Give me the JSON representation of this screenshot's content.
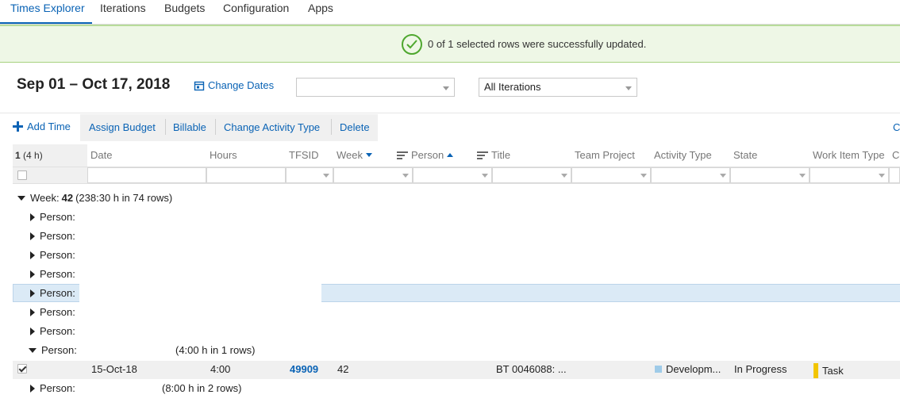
{
  "nav": {
    "tabs": [
      {
        "label": "Times Explorer",
        "active": true
      },
      {
        "label": "Iterations"
      },
      {
        "label": "Budgets"
      },
      {
        "label": "Configuration"
      },
      {
        "label": "Apps"
      }
    ]
  },
  "banner": {
    "message": "0 of 1 selected rows were successfully updated."
  },
  "header": {
    "date_range": "Sep 01 – Oct 17, 2018",
    "change_dates_label": "Change Dates",
    "project_dropdown_value": "",
    "iterations_dropdown_value": "All Iterations"
  },
  "toolbar": {
    "add_time": "Add Time",
    "assign_budget": "Assign Budget",
    "billable": "Billable",
    "change_activity_type": "Change Activity Type",
    "delete": "Delete",
    "overflow": "Co"
  },
  "grid": {
    "selection_count": "1",
    "selection_hours": "(4 h)",
    "columns": {
      "date": "Date",
      "hours": "Hours",
      "tfsid": "TFSID",
      "week": "Week",
      "person": "Person",
      "title": "Title",
      "team_project": "Team Project",
      "activity_type": "Activity Type",
      "state": "State",
      "work_item_type": "Work Item Type",
      "overflow": "Co"
    },
    "week_group": {
      "label": "Week:",
      "value": "42",
      "summary": "(238:30 h in 74 rows)"
    },
    "person_label": "Person:",
    "expanded_person_summary": "(4:00 h in 1 rows)",
    "next_person_summary": "(8:00 h in 2 rows)",
    "row": {
      "date": "15-Oct-18",
      "hours": "4:00",
      "tfsid": "49909",
      "week": "42",
      "title": "BT 0046088: ...",
      "activity_type": "Developm...",
      "state": "In Progress",
      "work_item_type": "Task"
    },
    "colors": {
      "activity_swatch": "#9fcbe8",
      "task_marker": "#f2c500",
      "selected_row": "#dbeaf6"
    }
  }
}
